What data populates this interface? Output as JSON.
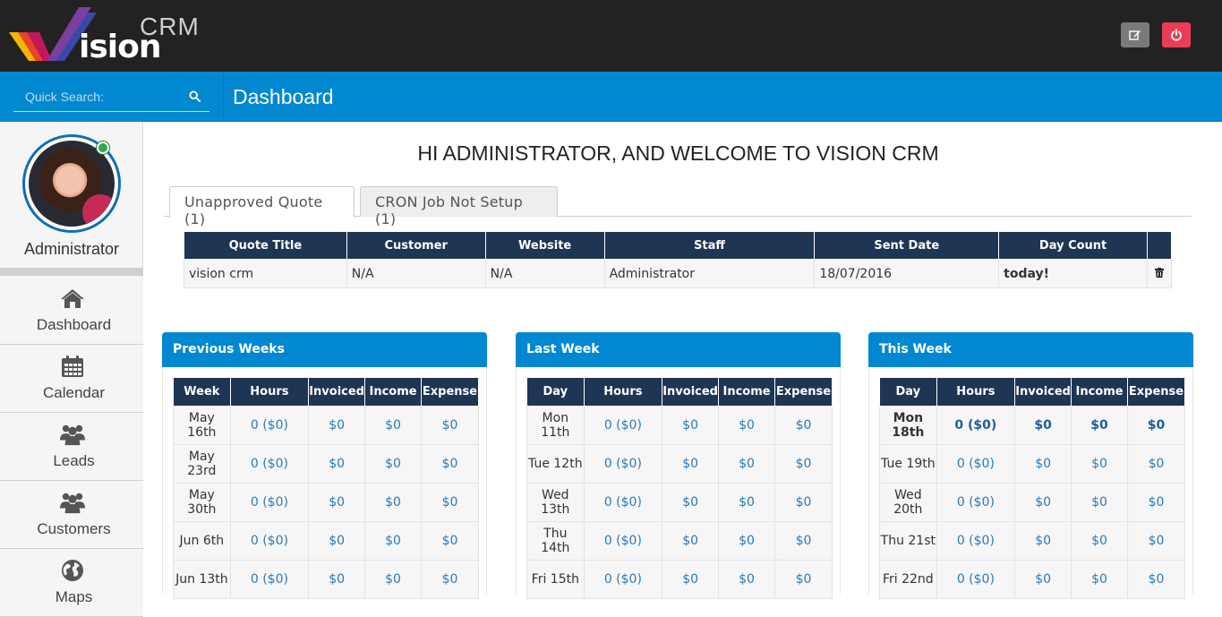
{
  "app": {
    "logo_crm": "CRM",
    "logo_vision": "ision"
  },
  "header": {
    "search_placeholder": "Quick Search:",
    "page_title": "Dashboard"
  },
  "sidebar": {
    "user_name": "Administrator",
    "items": [
      {
        "label": "Dashboard",
        "icon": "home-icon"
      },
      {
        "label": "Calendar",
        "icon": "calendar-icon"
      },
      {
        "label": "Leads",
        "icon": "users-icon"
      },
      {
        "label": "Customers",
        "icon": "users-icon"
      },
      {
        "label": "Maps",
        "icon": "globe-icon"
      }
    ]
  },
  "main": {
    "welcome": "HI ADMINISTRATOR, AND WELCOME TO VISION CRM",
    "tabs": [
      "Unapproved Quote (1)",
      "CRON Job Not Setup (1)"
    ],
    "quotes": {
      "headers": [
        "Quote Title",
        "Customer",
        "Website",
        "Staff",
        "Sent Date",
        "Day Count"
      ],
      "rows": [
        {
          "title": "vision crm",
          "customer": "N/A",
          "website": "N/A",
          "staff": "Administrator",
          "sent": "18/07/2016",
          "count": "today!"
        }
      ]
    }
  },
  "panels": [
    {
      "title": "Previous Weeks",
      "headers": [
        "Week",
        "Hours",
        "Invoiced",
        "Income",
        "Expense"
      ],
      "rows": [
        [
          "May 16th",
          "0 ($0)",
          "$0",
          "$0",
          "$0"
        ],
        [
          "May 23rd",
          "0 ($0)",
          "$0",
          "$0",
          "$0"
        ],
        [
          "May 30th",
          "0 ($0)",
          "$0",
          "$0",
          "$0"
        ],
        [
          "Jun 6th",
          "0 ($0)",
          "$0",
          "$0",
          "$0"
        ],
        [
          "Jun 13th",
          "0 ($0)",
          "$0",
          "$0",
          "$0"
        ]
      ]
    },
    {
      "title": "Last Week",
      "headers": [
        "Day",
        "Hours",
        "Invoiced",
        "Income",
        "Expense"
      ],
      "rows": [
        [
          "Mon 11th",
          "0 ($0)",
          "$0",
          "$0",
          "$0"
        ],
        [
          "Tue 12th",
          "0 ($0)",
          "$0",
          "$0",
          "$0"
        ],
        [
          "Wed 13th",
          "0 ($0)",
          "$0",
          "$0",
          "$0"
        ],
        [
          "Thu 14th",
          "0 ($0)",
          "$0",
          "$0",
          "$0"
        ],
        [
          "Fri 15th",
          "0 ($0)",
          "$0",
          "$0",
          "$0"
        ]
      ]
    },
    {
      "title": "This Week",
      "headers": [
        "Day",
        "Hours",
        "Invoiced",
        "Income",
        "Expense"
      ],
      "rows": [
        [
          "Mon 18th",
          "0 ($0)",
          "$0",
          "$0",
          "$0"
        ],
        [
          "Tue 19th",
          "0 ($0)",
          "$0",
          "$0",
          "$0"
        ],
        [
          "Wed 20th",
          "0 ($0)",
          "$0",
          "$0",
          "$0"
        ],
        [
          "Thu 21st",
          "0 ($0)",
          "$0",
          "$0",
          "$0"
        ],
        [
          "Fri 22nd",
          "0 ($0)",
          "$0",
          "$0",
          "$0"
        ]
      ]
    }
  ],
  "colors": {
    "topbar": "#222222",
    "accent": "#0288d1",
    "table_header": "#1e3554",
    "power_button": "#ea3d55",
    "today": "#d11c1c"
  }
}
